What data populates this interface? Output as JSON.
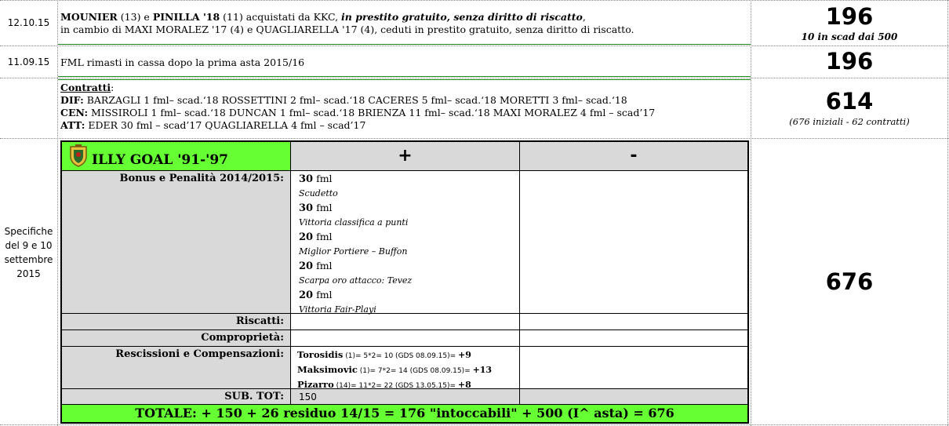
{
  "rows": [
    {
      "date": "12.10.15",
      "line1": {
        "p1": "MOUNIER",
        "p2": " (13) e ",
        "p3": "PINILLA '18",
        "p4": " (11) acquistati da KKC, ",
        "p5": "in prestito gratuito, senza diritto di riscatto",
        "p6": ","
      },
      "line2": "in cambio di MAXI MORALEZ '17 (4) e QUAGLIARELLA '17 (4), ceduti in prestito gratuito, senza diritto di riscatto.",
      "value": "196",
      "note": "10 in scad dai 500"
    },
    {
      "date": "11.09.15",
      "text": "FML rimasti in cassa dopo la prima asta 2015/16",
      "value": "196"
    },
    {
      "title": "Contratti",
      "colon": ":",
      "lines": [
        {
          "role": "DIF:",
          "text": " BARZAGLI 1 fml– scad.‘18  ROSSETTINI 2 fml– scad.‘18  CACERES 5 fml– scad.‘18  MORETTI 3 fml– scad.‘18"
        },
        {
          "role": "CEN:",
          "text": " MISSIROLI 1 fml– scad.‘18  DUNCAN 1 fml– scad.‘18  BRIENZA 11 fml– scad.‘18  MAXI MORALEZ 4 fml – scad’17"
        },
        {
          "role": "ATT:",
          "text": " EDER 30 fml – scad’17 QUAGLIARELLA 4 fml – scad’17"
        }
      ],
      "value": "614",
      "note": "(676 iniziali - 62 contratti)"
    },
    {
      "date": "Specifiche del 9 e 10 settembre 2015",
      "value": "676"
    }
  ],
  "table": {
    "team": "ILLY GOAL '91-'97",
    "plus": "+",
    "minus": "-",
    "bonus_label": "Bonus e Penalità 2014/2015:",
    "bonus": [
      {
        "amt": "30",
        "unit": " fml",
        "note": "Scudetto"
      },
      {
        "amt": "30",
        "unit": " fml",
        "note": "Vittoria classifica a punti"
      },
      {
        "amt": "20",
        "unit": " fml",
        "note": "Miglior Portiere – Buffon"
      },
      {
        "amt": "20",
        "unit": " fml",
        "note": "Scarpa oro attacco: Tevez"
      },
      {
        "amt": "20",
        "unit": " fml",
        "note": "Vittoria Fair-Playi"
      }
    ],
    "riscatti_label": "Riscatti:",
    "compro_label": "Comproprietà:",
    "resc_label": "Rescissioni e Compensazioni:",
    "resc": [
      {
        "name": "Torosidis",
        "calc": " (1)= 5*2= 10 (GDS 08.09.15)= ",
        "val": "+9"
      },
      {
        "name": "Maksimovic",
        "calc": " (1)= 7*2= 14 (GDS 08.09.15)= ",
        "val": "+13"
      },
      {
        "name": "Pizarro",
        "calc": " (14)= 11*2= 22 (GDS 13.05.15)= ",
        "val": "+8"
      }
    ],
    "subtot_label": "SUB. TOT:",
    "subtot_value": "150",
    "totale": "TOTALE: + 150 + 26 residuo 14/15 = 176 \"intoccabili\" + 500 (I^ asta) = 676"
  },
  "colors": {
    "green": "#66ff33",
    "grey": "#d9d9d9",
    "rule": "#1a8a1a"
  }
}
